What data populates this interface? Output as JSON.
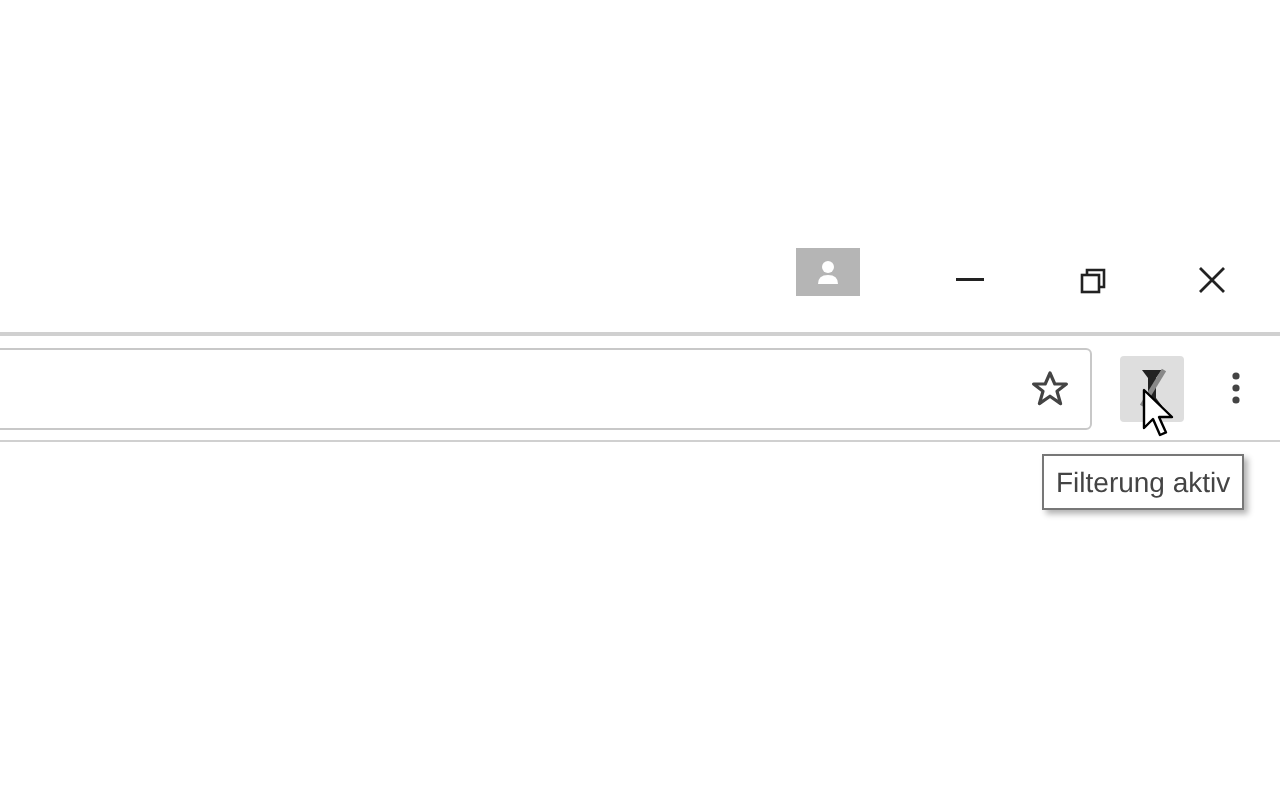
{
  "extension_button": {
    "hovered": true
  },
  "tooltip": {
    "text": "Filterung aktiv"
  }
}
